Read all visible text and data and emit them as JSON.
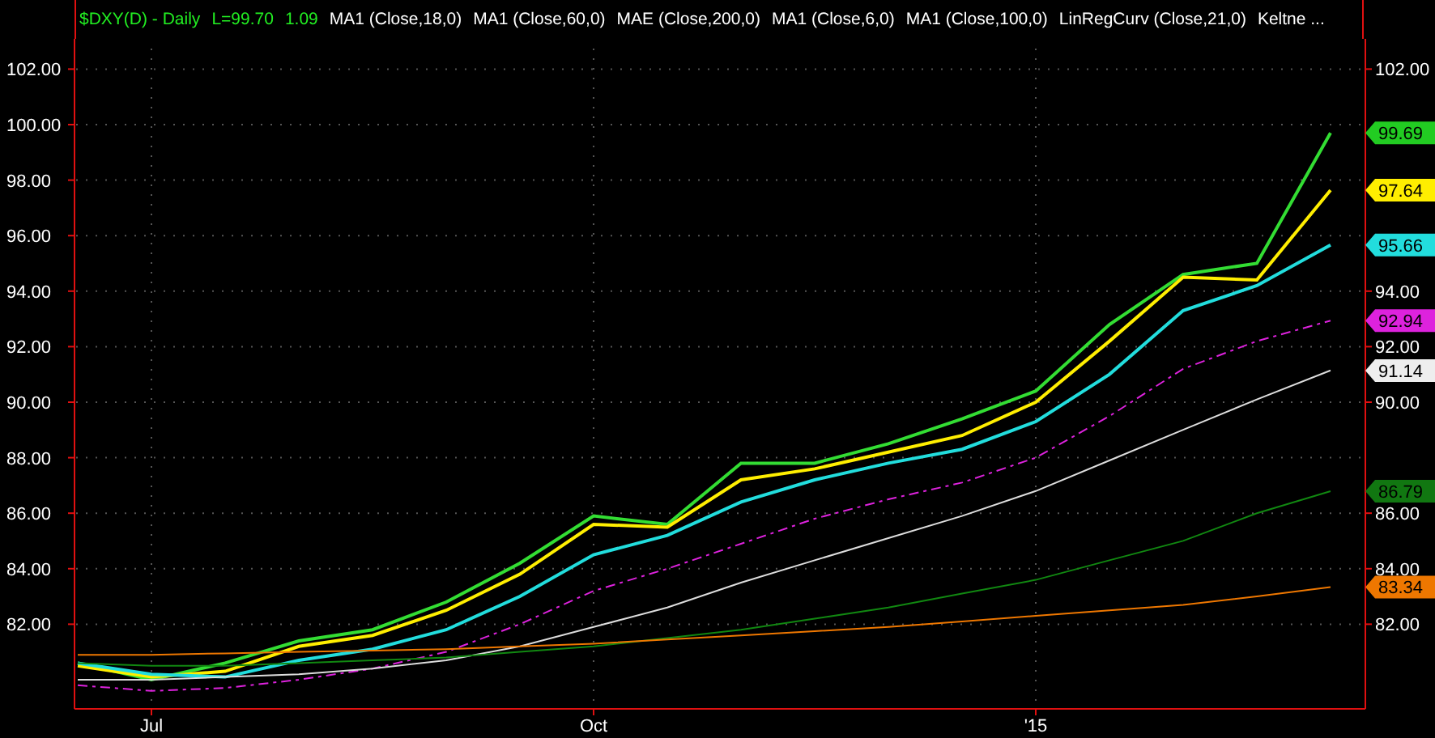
{
  "header": {
    "symbol": "$DXY(D) - Daily",
    "last": "L=99.70",
    "change": "1.09",
    "studies": [
      "MA1 (Close,18,0)",
      "MA1 (Close,60,0)",
      "MAE (Close,200,0)",
      "MA1 (Close,6,0)",
      "MA1 (Close,100,0)",
      "LinRegCurv (Close,21,0)",
      "Keltne ..."
    ]
  },
  "chart_data": {
    "type": "line",
    "categories": [
      null,
      "Jul",
      null,
      null,
      null,
      null,
      null,
      "Oct",
      null,
      null,
      null,
      null,
      null,
      "'15",
      null,
      null,
      null,
      null
    ],
    "yticks": [
      {
        "value": 102,
        "label": "102.00"
      },
      {
        "value": 100,
        "label": "100.00"
      },
      {
        "value": 98,
        "label": "98.00"
      },
      {
        "value": 96,
        "label": "96.00"
      },
      {
        "value": 94,
        "label": "94.00"
      },
      {
        "value": 92,
        "label": "92.00"
      },
      {
        "value": 90,
        "label": "90.00"
      },
      {
        "value": 88,
        "label": "88.00"
      },
      {
        "value": 86,
        "label": "86.00"
      },
      {
        "value": 84,
        "label": "84.00"
      },
      {
        "value": 82,
        "label": "82.00"
      }
    ],
    "ylim": [
      78.95,
      103.09
    ],
    "grid": true,
    "series": [
      {
        "color": "#33dd33",
        "values": [
          80.6,
          80.0,
          80.6,
          81.4,
          81.8,
          82.8,
          84.2,
          85.9,
          85.6,
          87.8,
          87.8,
          88.5,
          89.4,
          90.4,
          92.8,
          94.6,
          95.0,
          99.7
        ]
      },
      {
        "color": "#ffee00",
        "values": [
          80.5,
          80.1,
          80.3,
          81.2,
          81.6,
          82.5,
          83.8,
          85.6,
          85.5,
          87.2,
          87.6,
          88.2,
          88.8,
          90.0,
          92.2,
          94.5,
          94.4,
          97.64
        ]
      },
      {
        "color": "#22dddd",
        "values": [
          80.6,
          80.2,
          80.1,
          80.7,
          81.1,
          81.8,
          83.0,
          84.5,
          85.2,
          86.4,
          87.2,
          87.8,
          88.3,
          89.3,
          91.0,
          93.3,
          94.2,
          95.66
        ]
      },
      {
        "color": "#dd22dd",
        "line_style": "dashed",
        "values": [
          79.8,
          79.6,
          79.7,
          80.0,
          80.4,
          81.0,
          82.0,
          83.2,
          84.0,
          84.9,
          85.8,
          86.5,
          87.1,
          88.0,
          89.5,
          91.2,
          92.2,
          92.94
        ]
      },
      {
        "color": "#dddddd",
        "values": [
          80.0,
          80.0,
          80.1,
          80.2,
          80.4,
          80.7,
          81.2,
          81.9,
          82.6,
          83.5,
          84.3,
          85.1,
          85.9,
          86.8,
          87.9,
          89.0,
          90.1,
          91.14
        ]
      },
      {
        "color": "#118811",
        "values": [
          80.6,
          80.5,
          80.5,
          80.6,
          80.7,
          80.8,
          81.0,
          81.2,
          81.5,
          81.8,
          82.2,
          82.6,
          83.1,
          83.6,
          84.3,
          85.0,
          86.0,
          86.79
        ]
      },
      {
        "color": "#ee7700",
        "values": [
          80.9,
          80.9,
          80.95,
          81.0,
          81.05,
          81.1,
          81.2,
          81.3,
          81.45,
          81.6,
          81.75,
          81.9,
          82.1,
          82.3,
          82.5,
          82.7,
          83.0,
          83.34
        ]
      }
    ]
  },
  "right_axis_labels": [
    "102.00",
    "94.00",
    "92.00",
    "90.00",
    "86.00",
    "84.00",
    "82.00"
  ],
  "price_tags": [
    {
      "label": "99.69",
      "color": "#22cc22"
    },
    {
      "label": "97.64",
      "color": "#ffee00"
    },
    {
      "label": "95.66",
      "color": "#22dddd"
    },
    {
      "label": "92.94",
      "color": "#dd22dd"
    },
    {
      "label": "91.14",
      "color": "#eeeeee"
    },
    {
      "label": "86.79",
      "color": "#117711"
    },
    {
      "label": "83.34",
      "color": "#ee7700"
    }
  ]
}
